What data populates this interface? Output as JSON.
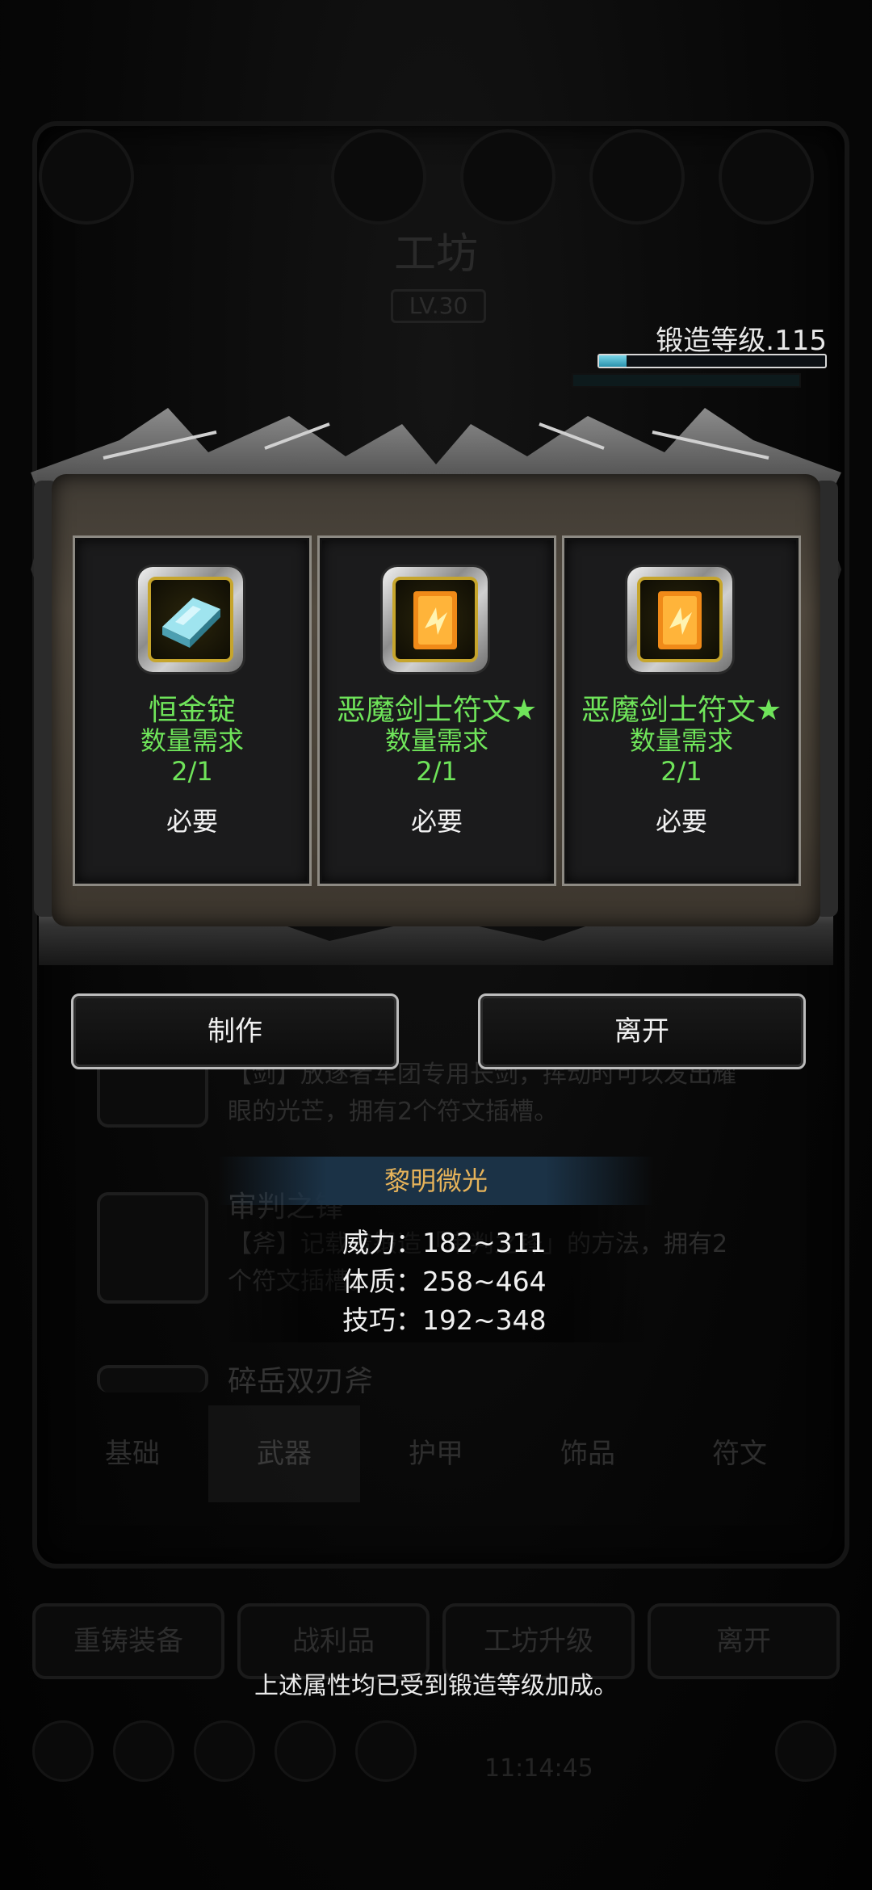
{
  "background": {
    "title": "工坊",
    "level": "LV.30",
    "forge_level": "锻造等级.115",
    "forge_progress": 0.12,
    "items": [
      {
        "name": "",
        "desc": "【剑】放逐者军团专用长剑，挥动时可以发出耀眼的光芒，拥有2个符文插槽。"
      },
      {
        "name": "审判之锋",
        "desc": "【斧】记载着锻造「审判之锋」的方法，拥有2个符文插槽。"
      },
      {
        "name": "碎岳双刃斧",
        "desc": ""
      }
    ],
    "tabs": [
      "基础",
      "武器",
      "护甲",
      "饰品",
      "符文"
    ],
    "active_tab": "武器",
    "bottom_buttons": [
      "重铸装备",
      "战利品",
      "工坊升级",
      "离开"
    ],
    "time": "11:14:45"
  },
  "craft_modal": {
    "materials": [
      {
        "name": "恒金锭",
        "req_label": "数量需求",
        "qty": "2/1",
        "requirement": "必要",
        "icon": "ingot-icon"
      },
      {
        "name": "恶魔剑士符文★",
        "req_label": "数量需求",
        "qty": "2/1",
        "requirement": "必要",
        "icon": "rune-icon"
      },
      {
        "name": "恶魔剑士符文★",
        "req_label": "数量需求",
        "qty": "2/1",
        "requirement": "必要",
        "icon": "rune-icon"
      }
    ],
    "craft_button": "制作",
    "leave_button": "离开"
  },
  "item_info": {
    "name": "黎明微光",
    "stats": [
      {
        "label": "威力：182~311"
      },
      {
        "label": "体质：258~464"
      },
      {
        "label": "技巧：192~348"
      }
    ],
    "note": "上述属性均已受到锻造等级加成。"
  },
  "colors": {
    "material_text": "#6fe45a",
    "info_title": "#e6b35a",
    "panel": "#4a4339"
  }
}
